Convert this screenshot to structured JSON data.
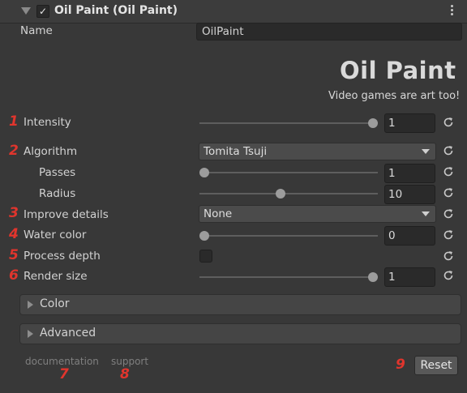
{
  "header": {
    "checkbox_mark": "✓",
    "title": "Oil Paint (Oil Paint)",
    "menu_icon": "kebab-menu-icon"
  },
  "name_field": {
    "label": "Name",
    "value": "OilPaint"
  },
  "logo": {
    "title": "Oil Paint",
    "tagline": "Video games are art too!"
  },
  "params": {
    "intensity": {
      "marker": "1",
      "label": "Intensity",
      "value": "1",
      "slider_fraction": 1.0
    },
    "algorithm": {
      "marker": "2",
      "label": "Algorithm",
      "value": "Tomita Tsuji"
    },
    "passes": {
      "label": "Passes",
      "value": "1",
      "slider_fraction": 0.0
    },
    "radius": {
      "label": "Radius",
      "value": "10",
      "slider_fraction": 0.45
    },
    "improve_details": {
      "marker": "3",
      "label": "Improve details",
      "value": "None"
    },
    "water_color": {
      "marker": "4",
      "label": "Water color",
      "value": "0",
      "slider_fraction": 0.0
    },
    "process_depth": {
      "marker": "5",
      "label": "Process depth",
      "checked": false
    },
    "render_size": {
      "marker": "6",
      "label": "Render size",
      "value": "1",
      "slider_fraction": 1.0
    }
  },
  "sections": {
    "color": "Color",
    "advanced": "Advanced"
  },
  "footer": {
    "documentation": "documentation",
    "documentation_marker": "7",
    "support": "support",
    "support_marker": "8",
    "reset_marker": "9",
    "reset_label": "Reset"
  },
  "colors": {
    "background": "#383838",
    "marker_red": "#e0352d",
    "field": "#2a2a2a"
  }
}
